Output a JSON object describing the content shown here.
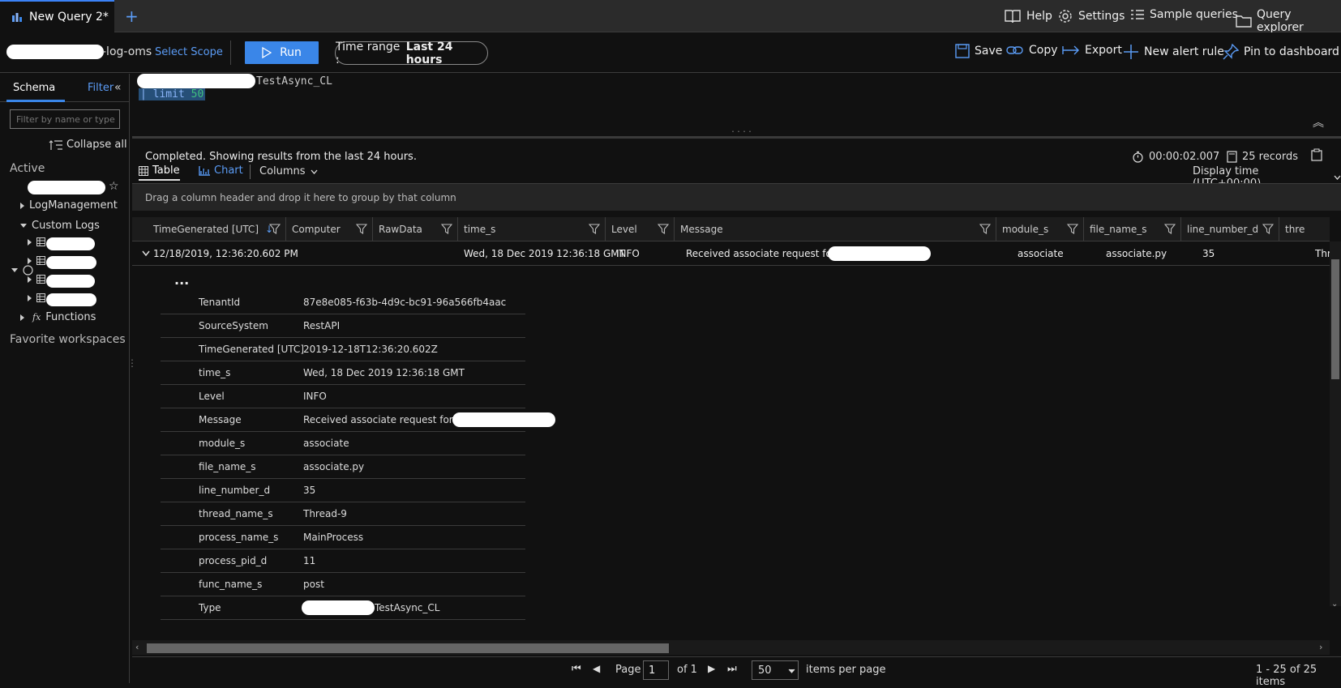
{
  "tabs": {
    "active_label": "New Query 2*",
    "add_label": "+"
  },
  "top_links": {
    "help": "Help",
    "settings": "Settings",
    "samples": "Sample queries",
    "explorer": "Query explorer"
  },
  "toolbar": {
    "scope_suffix": "-log-oms",
    "select_scope": "Select Scope",
    "run": "Run",
    "time_range_label": "Time range :",
    "time_range_value": "Last 24 hours",
    "save": "Save",
    "copy": "Copy",
    "export": "Export",
    "new_alert": "New alert rule",
    "pin": "Pin to dashboard"
  },
  "sidebar": {
    "schema_tab": "Schema",
    "filter_tab": "Filter",
    "filter_placeholder": "Filter by name or type",
    "collapse_all": "Collapse all",
    "active_heading": "Active",
    "log_management": "LogManagement",
    "custom_logs": "Custom Logs",
    "functions": "Functions",
    "favorite_workspaces": "Favorite workspaces"
  },
  "editor": {
    "line1_suffix": "TestAsync_CL",
    "line2": "| limit 50"
  },
  "results": {
    "status": "Completed. Showing results from the last 24 hours.",
    "duration": "00:00:02.007",
    "records": "25 records",
    "view_table": "Table",
    "view_chart": "Chart",
    "columns": "Columns",
    "display_time": "Display time (UTC+00:00)",
    "group_hint": "Drag a column header and drop it here to group by that column"
  },
  "grid": {
    "headers": [
      "TimeGenerated [UTC]",
      "Computer",
      "RawData",
      "time_s",
      "Level",
      "Message",
      "module_s",
      "file_name_s",
      "line_number_d",
      "thre"
    ],
    "row": {
      "time_generated": "12/18/2019, 12:36:20.602 PM",
      "time_s": "Wed, 18 Dec 2019 12:36:18 GMT",
      "level": "INFO",
      "message": "Received associate request for:",
      "module_s": "associate",
      "file_name_s": "associate.py",
      "line_number_d": "35",
      "thread": "Thr"
    },
    "ellipsis": "...",
    "details": [
      {
        "key": "TenantId",
        "value": "87e8e085-f63b-4d9c-bc91-96a566fb4aac"
      },
      {
        "key": "SourceSystem",
        "value": "RestAPI"
      },
      {
        "key": "TimeGenerated [UTC]",
        "value": "2019-12-18T12:36:20.602Z"
      },
      {
        "key": "time_s",
        "value": "Wed, 18 Dec 2019 12:36:18 GMT"
      },
      {
        "key": "Level",
        "value": "INFO"
      },
      {
        "key": "Message",
        "value": "Received associate request for:"
      },
      {
        "key": "module_s",
        "value": "associate"
      },
      {
        "key": "file_name_s",
        "value": "associate.py"
      },
      {
        "key": "line_number_d",
        "value": "35"
      },
      {
        "key": "thread_name_s",
        "value": "Thread-9"
      },
      {
        "key": "process_name_s",
        "value": "MainProcess"
      },
      {
        "key": "process_pid_d",
        "value": "11"
      },
      {
        "key": "func_name_s",
        "value": "post"
      },
      {
        "key": "Type",
        "value": "TestAsync_CL"
      }
    ]
  },
  "pager": {
    "page_label": "Page",
    "page_value": "1",
    "of_label": "of 1",
    "page_size": "50",
    "items_per_page": "items per page",
    "summary": "1 - 25 of 25 items"
  },
  "colors": {
    "accent": "#3a86e8",
    "link": "#5b9cf6",
    "background": "#111111"
  }
}
